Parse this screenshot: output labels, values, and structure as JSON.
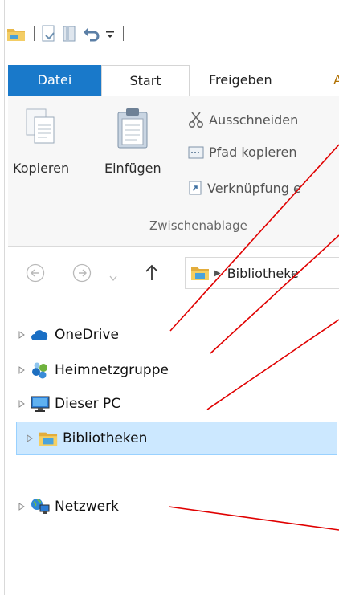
{
  "ribbon": {
    "tabs": {
      "datei": "Datei",
      "start": "Start",
      "freigeben": "Freigeben",
      "more": "A"
    },
    "clipboard": {
      "copy": "Kopieren",
      "paste": "Einfügen",
      "cut": "Ausschneiden",
      "copy_path": "Pfad kopieren",
      "paste_shortcut": "Verknüpfung e",
      "group_label": "Zwischenablage"
    }
  },
  "address": {
    "breadcrumb": "Bibliotheke"
  },
  "nav_tree": [
    {
      "label": "OneDrive",
      "icon": "onedrive-cloud-icon"
    },
    {
      "label": "Heimnetzgruppe",
      "icon": "homegroup-icon"
    },
    {
      "label": "Dieser PC",
      "icon": "computer-monitor-icon"
    },
    {
      "label": "Bibliotheken",
      "icon": "libraries-folder-icon",
      "selected": true
    },
    {
      "label": "Netzwerk",
      "icon": "network-globe-icon"
    }
  ],
  "colors": {
    "accent": "#1979ca",
    "selection_bg": "#cce8ff",
    "selection_border": "#99d1ff",
    "annotation_lines": "#e00000"
  }
}
